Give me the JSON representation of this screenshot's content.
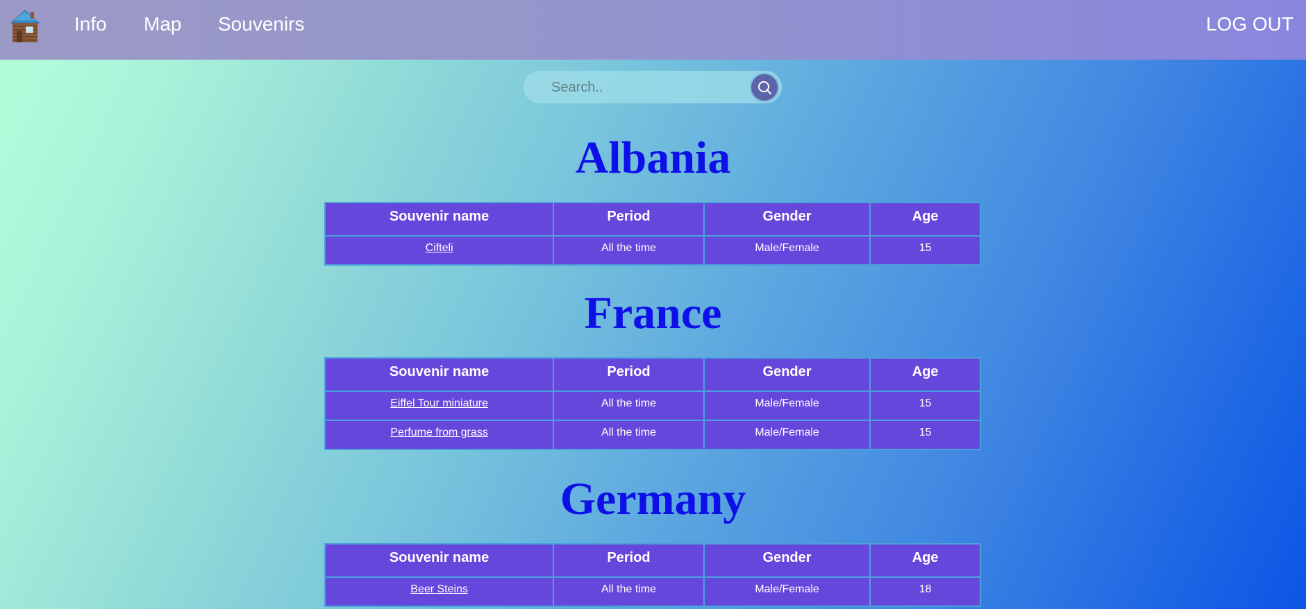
{
  "nav": {
    "logo_icon": "log-cabin-icon",
    "links": [
      "Info",
      "Map",
      "Souvenirs"
    ],
    "logout": "LOG OUT"
  },
  "search": {
    "placeholder": "Search..",
    "icon": "search-icon"
  },
  "headers": [
    "Souvenir name",
    "Period",
    "Gender",
    "Age"
  ],
  "countries": [
    {
      "name": "Albania",
      "rows": [
        {
          "name": "Cifteli",
          "period": "All the time",
          "gender": "Male/Female",
          "age": "15"
        }
      ]
    },
    {
      "name": "France",
      "rows": [
        {
          "name": "Eiffel Tour miniature",
          "period": "All the time",
          "gender": "Male/Female",
          "age": "15"
        },
        {
          "name": "Perfume from grass",
          "period": "All the time",
          "gender": "Male/Female",
          "age": "15"
        }
      ]
    },
    {
      "name": "Germany",
      "rows": [
        {
          "name": "Beer Steins",
          "period": "All the time",
          "gender": "Male/Female",
          "age": "18"
        }
      ]
    }
  ],
  "colors": {
    "navbar": "#9495cb",
    "table_bg": "#6647db",
    "table_border": "#4aa2dc",
    "country_title": "#0e10e8",
    "search_button": "#5d63a8"
  }
}
